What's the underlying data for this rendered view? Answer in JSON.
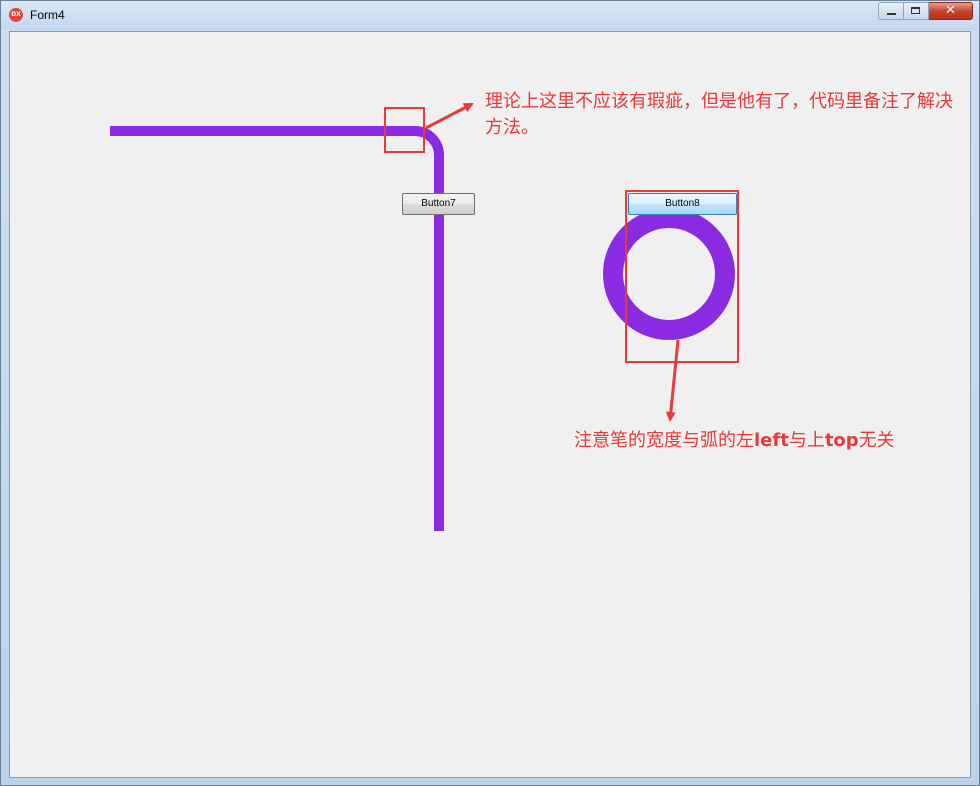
{
  "window": {
    "title": "Form4",
    "icon": "app-icon",
    "icon_text": "DX"
  },
  "caption_buttons": {
    "minimize": "minimize-icon",
    "maximize": "maximize-icon",
    "close": "close-icon",
    "close_glyph": "✕"
  },
  "buttons": {
    "button7": "Button7",
    "button8": "Button8"
  },
  "annotations": {
    "note1": "理论上这里不应该有瑕疵，但是他有了，代码里备注了解决方法。",
    "note2_part1": "注意笔的宽度与弧的左",
    "note2_left": "left",
    "note2_part2": "与上",
    "note2_top": "top",
    "note2_part3": "无关"
  },
  "colors": {
    "pen": "#8a2be2",
    "annotation": "#e8393b",
    "form_background": "#f0f0f0"
  }
}
